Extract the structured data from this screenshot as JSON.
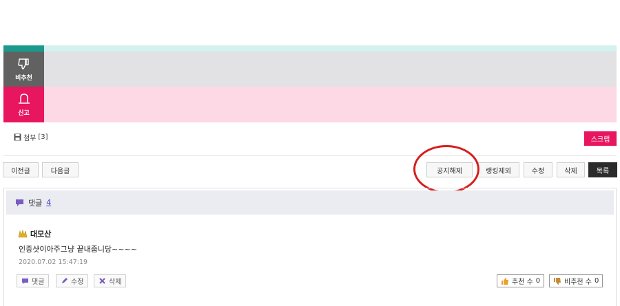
{
  "vote": {
    "dislike_label": "비추천",
    "report_label": "신고"
  },
  "attachment": {
    "label": "첨부",
    "count": "[3]"
  },
  "scrap_label": "스크랩",
  "nav": {
    "prev_label": "이전글",
    "next_label": "다음글",
    "unpin_label": "공지해제",
    "ranking_exclude_label": "랭킹제외",
    "edit_label": "수정",
    "delete_label": "삭제",
    "list_label": "목록"
  },
  "comments": {
    "title": "댓글",
    "count": "4",
    "items": [
      {
        "author": "대모산",
        "text": "인증샷이아주그냥 끝내줍니당~~~~",
        "date": "2020.07.02 15:47:19",
        "reply_label": "댓글",
        "edit_label": "수정",
        "delete_label": "삭제",
        "like_label": "추천 수",
        "like_count": "0",
        "dislike_label": "비추천 수",
        "dislike_count": "0"
      }
    ]
  },
  "colors": {
    "accent_pink": "#e8155f",
    "teal": "#1a9a8c",
    "highlight": "#d61f1f"
  }
}
